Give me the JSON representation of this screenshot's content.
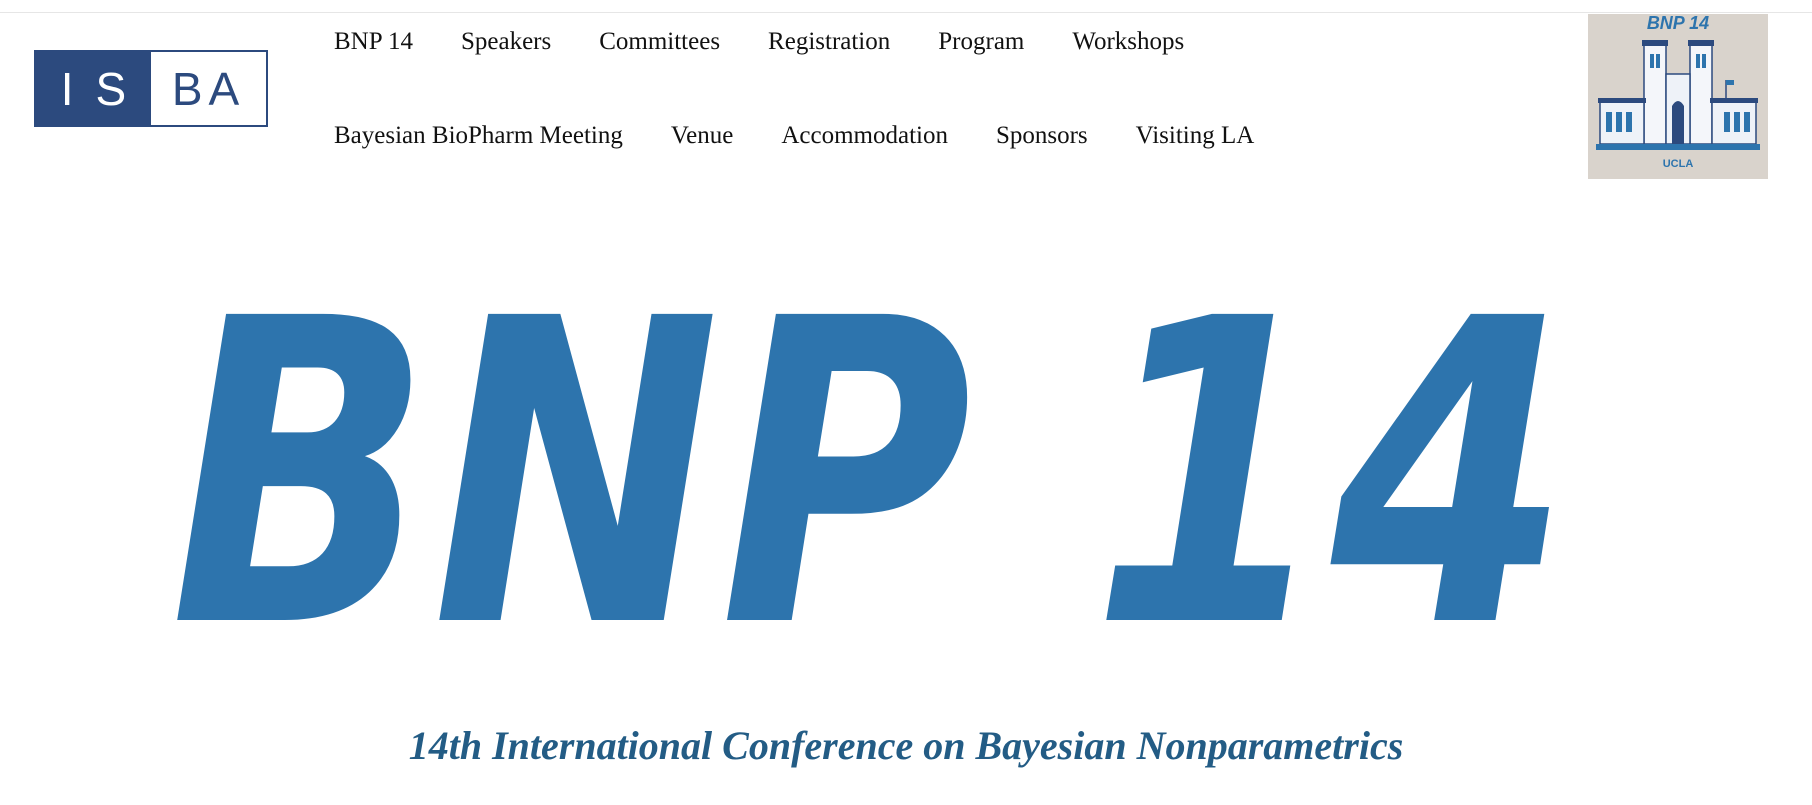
{
  "logo": {
    "left_text": "IS",
    "right_text": "BA",
    "color": "#2c4a7e"
  },
  "nav": {
    "row1": [
      "BNP 14",
      "Speakers",
      "Committees",
      "Registration",
      "Program",
      "Workshops"
    ],
    "row2": [
      "Bayesian BioPharm Meeting",
      "Venue",
      "Accommodation",
      "Sponsors",
      "Visiting LA"
    ]
  },
  "badge": {
    "title": "BNP 14",
    "caption": "UCLA",
    "icon": "royce-hall-illustration"
  },
  "hero": {
    "text": "BNP 14",
    "color": "#2d74ad"
  },
  "subtitle": "14th International Conference on Bayesian Nonparametrics",
  "colors": {
    "subtitle": "#235c85",
    "hero": "#2d74ad"
  }
}
